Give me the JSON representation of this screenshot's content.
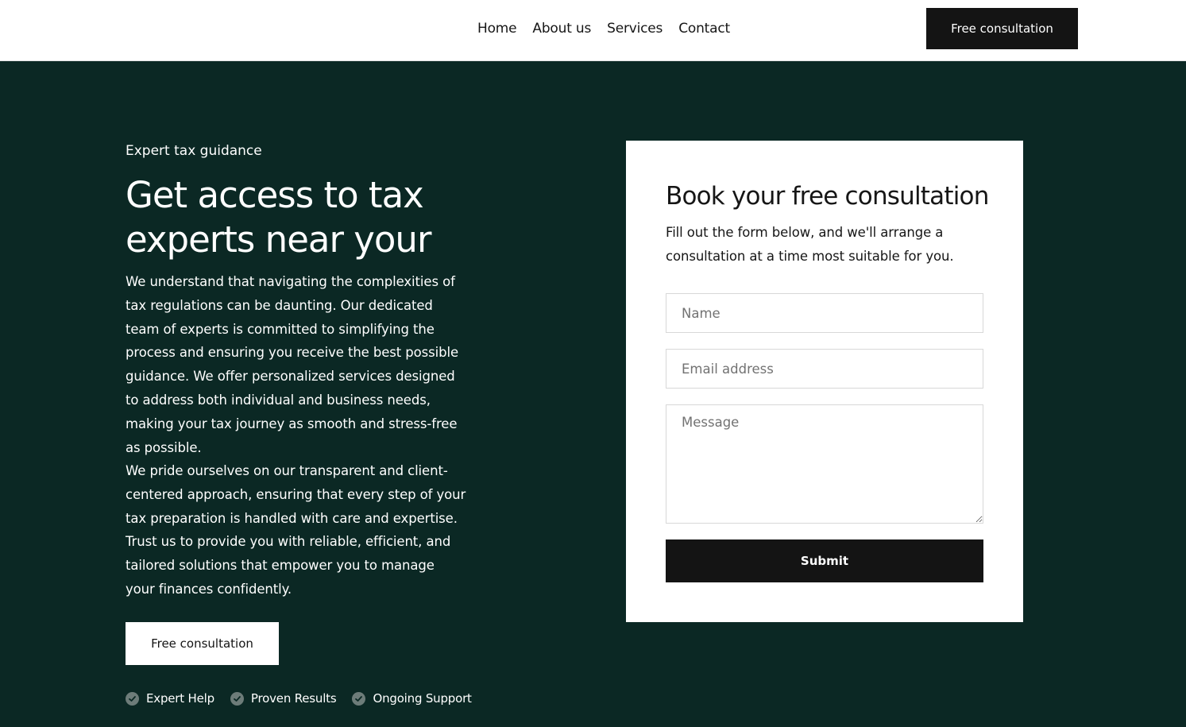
{
  "colors": {
    "hero_bg": "#0b2824",
    "header_bg": "#ffffff",
    "dark_button": "#141414",
    "check_icon": "#6d7c79"
  },
  "header": {
    "nav": [
      "Home",
      "About us",
      "Services",
      "Contact"
    ],
    "cta_label": "Free consultation"
  },
  "hero": {
    "eyebrow": "Expert tax guidance",
    "title": "Get access to tax experts near your",
    "paragraph_1": "We understand that navigating the complexities of tax regulations can be daunting. Our dedicated team of experts is committed to simplifying the process and ensuring you receive the best possible guidance. We offer personalized services designed to address both individual and business needs, making your tax journey as smooth and stress-free as possible.",
    "paragraph_2": "We pride ourselves on our transparent and client-centered approach, ensuring that every step of your tax preparation is handled with care and expertise. Trust us to provide you with reliable, efficient, and tailored solutions that empower you to manage your finances confidently.",
    "cta_label": "Free consultation",
    "features": [
      {
        "label": "Expert Help",
        "icon": "check-circle-icon"
      },
      {
        "label": "Proven Results",
        "icon": "check-circle-icon"
      },
      {
        "label": "Ongoing Support",
        "icon": "check-circle-icon"
      }
    ]
  },
  "form": {
    "title": "Book your free consultation",
    "description": "Fill out the form below, and we'll arrange a consultation at a time most suitable for you.",
    "name_placeholder": "Name",
    "email_placeholder": "Email address",
    "message_placeholder": "Message",
    "submit_label": "Submit"
  }
}
